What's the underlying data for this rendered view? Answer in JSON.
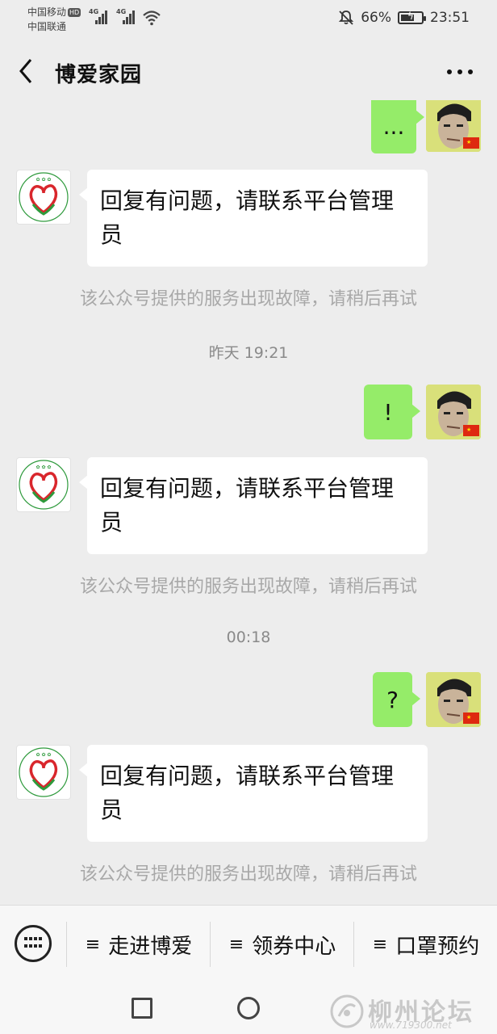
{
  "status_bar": {
    "carrier1": "中国移动",
    "carrier1_badge": "HD",
    "carrier2": "中国联通",
    "network1": "4G",
    "network2": "4G",
    "battery": "66%",
    "battery_level": 0.66,
    "time": "23:51"
  },
  "header": {
    "title": "博爱家园"
  },
  "messages": {
    "out1": "...",
    "in1": "回复有问题，请联系平台管理员",
    "note1": "该公众号提供的服务出现故障，请稍后再试",
    "time1": "昨天 19:21",
    "out2": "!",
    "in2": "回复有问题，请联系平台管理员",
    "note2": "该公众号提供的服务出现故障，请稍后再试",
    "time2": "00:18",
    "out3": "?",
    "in3": "回复有问题，请联系平台管理员",
    "note3": "该公众号提供的服务出现故障，请稍后再试"
  },
  "menu": {
    "item1": "走进博爱",
    "item2": "领券中心",
    "item3": "口罩预约"
  },
  "watermark": {
    "text": "柳州论坛",
    "url": "www.719300.net"
  },
  "colors": {
    "outgoing_bubble": "#95ec69",
    "incoming_bubble": "#ffffff",
    "background": "#ededed",
    "logo_red": "#d9262c",
    "logo_green": "#2e9a3c"
  }
}
